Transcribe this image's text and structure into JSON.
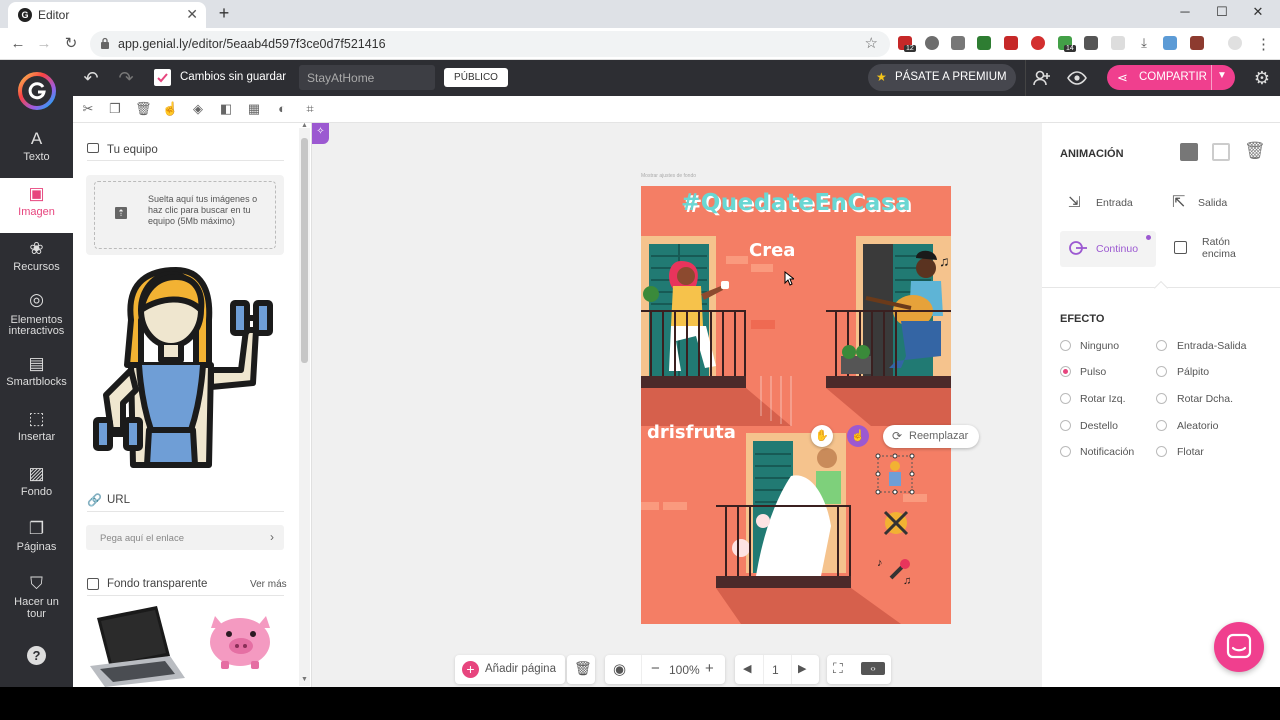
{
  "browser": {
    "tab_title": "Editor",
    "url": "app.genial.ly/editor/5eaab4d597f3ce0d7f521416",
    "new_tab": "+",
    "minimize": "─",
    "maximize": "☐",
    "close": "✕",
    "ext_badges": [
      "12",
      "14"
    ]
  },
  "header": {
    "unsaved": "Cambios sin guardar",
    "title_value": "StayAtHome",
    "visibility": "PÚBLICO",
    "premium": "PÁSATE A PREMIUM",
    "share": "COMPARTIR"
  },
  "leftnav": [
    {
      "icon": "text-icon",
      "label": "Texto"
    },
    {
      "icon": "image-icon",
      "label": "Imagen"
    },
    {
      "icon": "resources-icon",
      "label": "Recursos"
    },
    {
      "icon": "interactive-icon",
      "label": "Elementos interactivos"
    },
    {
      "icon": "smartblocks-icon",
      "label": "Smartblocks"
    },
    {
      "icon": "insert-icon",
      "label": "Insertar"
    },
    {
      "icon": "background-icon",
      "label": "Fondo"
    },
    {
      "icon": "pages-icon",
      "label": "Páginas"
    },
    {
      "icon": "tour-icon",
      "label": "Hacer un tour"
    }
  ],
  "leftpanel": {
    "team_header": "Tu equipo",
    "drop_text": "Suelta aquí tus imágenes o haz clic para buscar en tu equipo (5Mb máximo)",
    "url_header": "URL",
    "url_placeholder": "Pega aquí el enlace",
    "transparent_header": "Fondo transparente",
    "see_more": "Ver más"
  },
  "canvas": {
    "page_tag": "Mostrar ajustes de fondo",
    "heading": "#QuedateEnCasa",
    "word_create": "Crea",
    "word_enjoy": "drisfruta",
    "replace_label": "Reemplazar",
    "colors": {
      "page": "#f47e65",
      "accent": "#e7457e",
      "purple": "#9c59d1"
    }
  },
  "rightpanel": {
    "animation_header": "ANIMACIÓN",
    "triggers": [
      {
        "label": "Entrada",
        "active": false
      },
      {
        "label": "Salida",
        "active": false
      },
      {
        "label": "Continuo",
        "active": true
      },
      {
        "label": "Ratón encima",
        "active": false
      }
    ],
    "effect_header": "EFECTO",
    "effects": [
      {
        "label": "Ninguno",
        "selected": false
      },
      {
        "label": "Entrada-Salida",
        "selected": false
      },
      {
        "label": "Pulso",
        "selected": true
      },
      {
        "label": "Pálpito",
        "selected": false
      },
      {
        "label": "Rotar Izq.",
        "selected": false
      },
      {
        "label": "Rotar Dcha.",
        "selected": false
      },
      {
        "label": "Destello",
        "selected": false
      },
      {
        "label": "Aleatorio",
        "selected": false
      },
      {
        "label": "Notificación",
        "selected": false
      },
      {
        "label": "Flotar",
        "selected": false
      }
    ]
  },
  "bottom": {
    "add_page": "Añadir página",
    "zoom_out": "−",
    "zoom": "100%",
    "zoom_in": "+",
    "page_number": "1"
  }
}
